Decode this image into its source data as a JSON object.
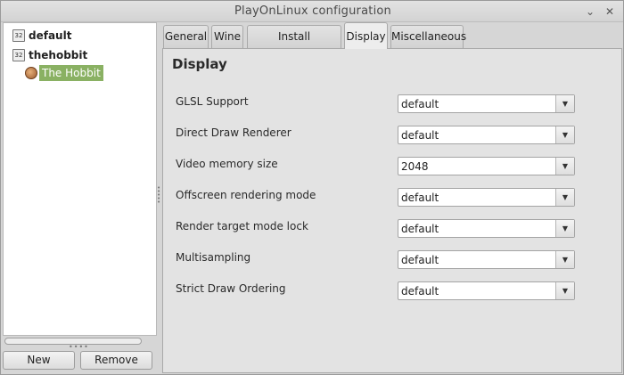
{
  "window": {
    "title": "PlayOnLinux configuration",
    "minimize_glyph": "⌄",
    "close_glyph": "✕"
  },
  "tree": {
    "items": [
      {
        "label": "default",
        "icon": "prefix-32bit-icon",
        "icon_text": "32"
      },
      {
        "label": "thehobbit",
        "icon": "prefix-32bit-icon",
        "icon_text": "32"
      },
      {
        "label": "The Hobbit",
        "icon": "game-icon",
        "selected": true
      }
    ]
  },
  "buttons": {
    "new": "New",
    "remove": "Remove"
  },
  "tabs": [
    {
      "label": "General"
    },
    {
      "label": "Wine"
    },
    {
      "label": "Install components"
    },
    {
      "label": "Display",
      "active": true
    },
    {
      "label": "Miscellaneous"
    }
  ],
  "display": {
    "title": "Display",
    "settings": [
      {
        "label": "GLSL Support",
        "value": "default"
      },
      {
        "label": "Direct Draw Renderer",
        "value": "default"
      },
      {
        "label": "Video memory size",
        "value": "2048"
      },
      {
        "label": "Offscreen rendering mode",
        "value": "default"
      },
      {
        "label": "Render target mode lock",
        "value": "default"
      },
      {
        "label": "Multisampling",
        "value": "default"
      },
      {
        "label": "Strict Draw Ordering",
        "value": "default"
      }
    ]
  },
  "colors": {
    "selection": "#8ab163",
    "window_bg": "#d6d6d6",
    "panel_bg": "#e3e3e3"
  }
}
